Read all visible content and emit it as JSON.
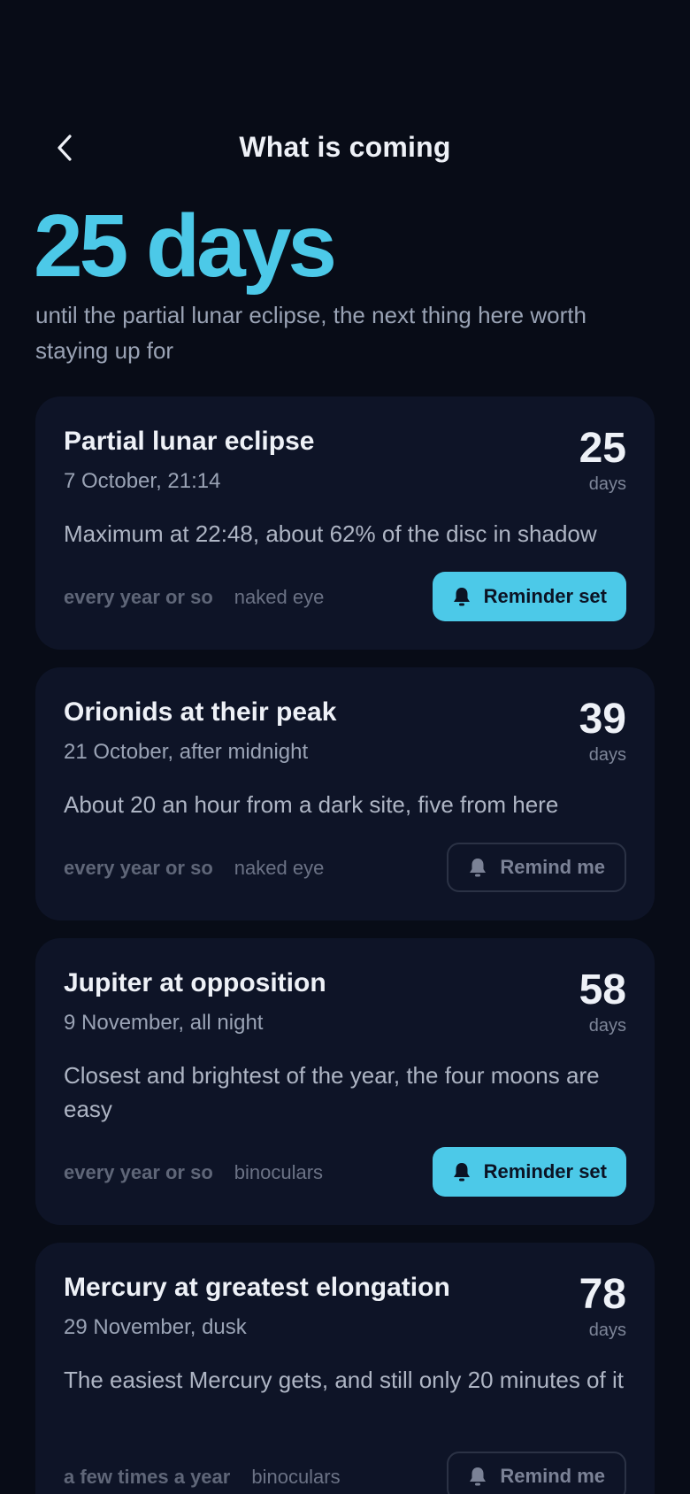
{
  "header": {
    "title": "What is coming"
  },
  "hero": {
    "count": "25 days",
    "subtitle": "until the partial lunar eclipse, the next thing here worth staying up for"
  },
  "colors": {
    "accent": "#4cc9e8",
    "background": "#080c17",
    "card": "#0e1427"
  },
  "events": [
    {
      "title": "Partial lunar eclipse",
      "date": "7 October, 21:14",
      "count": "25",
      "unit": "days",
      "description": "Maximum at 22:48, about 62% of the disc in shadow",
      "frequency": "every year or so",
      "method": "naked eye",
      "button": "Reminder set",
      "button_state": "set",
      "button_icon": "bell-icon"
    },
    {
      "title": "Orionids at their peak",
      "date": "21 October, after midnight",
      "count": "39",
      "unit": "days",
      "description": "About 20 an hour from a dark site, five from here",
      "frequency": "every year or so",
      "method": "naked eye",
      "button": "Remind me",
      "button_state": "unset",
      "button_icon": "bell-icon"
    },
    {
      "title": "Jupiter at opposition",
      "date": "9 November, all night",
      "count": "58",
      "unit": "days",
      "description": "Closest and brightest of the year, the four moons are easy",
      "frequency": "every year or so",
      "method": "binoculars",
      "button": "Reminder set",
      "button_state": "set",
      "button_icon": "bell-icon"
    },
    {
      "title": "Mercury at greatest elongation",
      "date": "29 November, dusk",
      "count": "78",
      "unit": "days",
      "description": "The easiest Mercury gets, and still only 20 minutes of it",
      "frequency": "a few times a year",
      "method": "binoculars",
      "button": "Remind me",
      "button_state": "unset",
      "button_icon": "bell-icon"
    }
  ]
}
